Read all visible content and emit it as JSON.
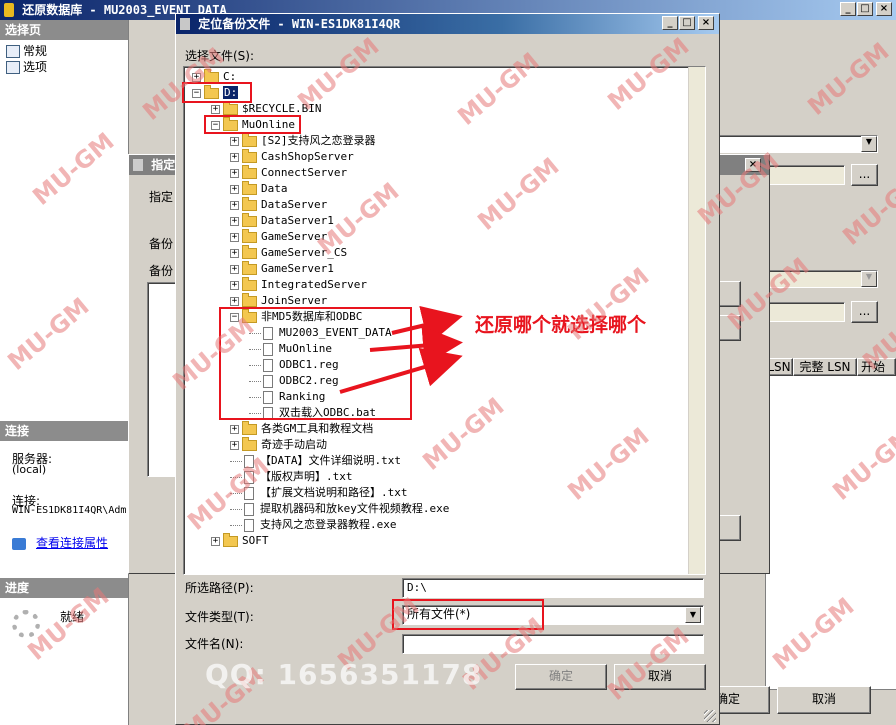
{
  "bg_window": {
    "title": "还原数据库 - MU2003_EVENT_DATA",
    "select_page_header": "选择页",
    "pages": [
      {
        "label": "常规"
      },
      {
        "label": "选项"
      }
    ],
    "connection_header": "连接",
    "server_label": "服务器:",
    "server_value": "(local)",
    "connection_label": "连接:",
    "connection_value": "WIN-ES1DK81I4QR\\Adm",
    "view_conn_props": "查看连接属性",
    "progress_header": "进度",
    "progress_status": "就绪",
    "ok_label": "确定",
    "cancel_label": "取消",
    "col_lsn": "LSN",
    "col_full_lsn": "完整 LSN",
    "col_start": "开始",
    "browse_label": "..."
  },
  "mid_dialog": {
    "title": "指定",
    "label_specify": "指定",
    "label_backup1": "备份",
    "label_backup2": "备份"
  },
  "dialog": {
    "title": "定位备份文件 - WIN-ES1DK81I4QR",
    "select_file_label": "选择文件(S):",
    "tree": [
      {
        "label": "C:",
        "level": 0,
        "kind": "folder",
        "expander": "+"
      },
      {
        "label": "D:",
        "level": 0,
        "kind": "folder",
        "expander": "-"
      },
      {
        "label": "$RECYCLE.BIN",
        "level": 1,
        "kind": "folder",
        "expander": "+"
      },
      {
        "label": "MuOnline",
        "level": 1,
        "kind": "folder",
        "expander": "-"
      },
      {
        "label": "[S2]支持风之恋登录器",
        "level": 2,
        "kind": "folder",
        "expander": "+"
      },
      {
        "label": "CashShopServer",
        "level": 2,
        "kind": "folder",
        "expander": "+"
      },
      {
        "label": "ConnectServer",
        "level": 2,
        "kind": "folder",
        "expander": "+"
      },
      {
        "label": "Data",
        "level": 2,
        "kind": "folder",
        "expander": "+"
      },
      {
        "label": "DataServer",
        "level": 2,
        "kind": "folder",
        "expander": "+"
      },
      {
        "label": "DataServer1",
        "level": 2,
        "kind": "folder",
        "expander": "+"
      },
      {
        "label": "GameServer",
        "level": 2,
        "kind": "folder",
        "expander": "+"
      },
      {
        "label": "GameServer_CS",
        "level": 2,
        "kind": "folder",
        "expander": "+"
      },
      {
        "label": "GameServer1",
        "level": 2,
        "kind": "folder",
        "expander": "+"
      },
      {
        "label": "IntegratedServer",
        "level": 2,
        "kind": "folder",
        "expander": "+"
      },
      {
        "label": "JoinServer",
        "level": 2,
        "kind": "folder",
        "expander": "+"
      },
      {
        "label": "非MD5数据库和ODBC",
        "level": 2,
        "kind": "folder",
        "expander": "-"
      },
      {
        "label": "MU2003_EVENT_DATA",
        "level": 3,
        "kind": "file",
        "expander": ""
      },
      {
        "label": "MuOnline",
        "level": 3,
        "kind": "file",
        "expander": ""
      },
      {
        "label": "ODBC1.reg",
        "level": 3,
        "kind": "file",
        "expander": ""
      },
      {
        "label": "ODBC2.reg",
        "level": 3,
        "kind": "file",
        "expander": ""
      },
      {
        "label": "Ranking",
        "level": 3,
        "kind": "file",
        "expander": ""
      },
      {
        "label": "双击载入ODBC.bat",
        "level": 3,
        "kind": "file",
        "expander": ""
      },
      {
        "label": "各类GM工具和教程文档",
        "level": 2,
        "kind": "folder",
        "expander": "+"
      },
      {
        "label": "奇迹手动启动",
        "level": 2,
        "kind": "folder",
        "expander": "+"
      },
      {
        "label": "【DATA】文件详细说明.txt",
        "level": 2,
        "kind": "file",
        "expander": ""
      },
      {
        "label": "【版权声明】.txt",
        "level": 2,
        "kind": "file",
        "expander": ""
      },
      {
        "label": "【扩展文档说明和路径】.txt",
        "level": 2,
        "kind": "file",
        "expander": ""
      },
      {
        "label": "提取机器码和放key文件视频教程.exe",
        "level": 2,
        "kind": "file",
        "expander": ""
      },
      {
        "label": "支持风之恋登录器教程.exe",
        "level": 2,
        "kind": "file",
        "expander": ""
      },
      {
        "label": "SOFT",
        "level": 1,
        "kind": "folder",
        "expander": "+"
      }
    ],
    "path_label": "所选路径(P):",
    "path_value": "D:\\",
    "filetype_label": "文件类型(T):",
    "filetype_value": "所有文件(*)",
    "filename_label": "文件名(N):",
    "filename_value": "",
    "ok_label": "确定",
    "cancel_label": "取消"
  },
  "annotation": {
    "text": "还原哪个就选择哪个",
    "color": "#e8141e"
  },
  "watermark": {
    "text": "MU-GM",
    "qq": "QQ: 1656351178"
  }
}
